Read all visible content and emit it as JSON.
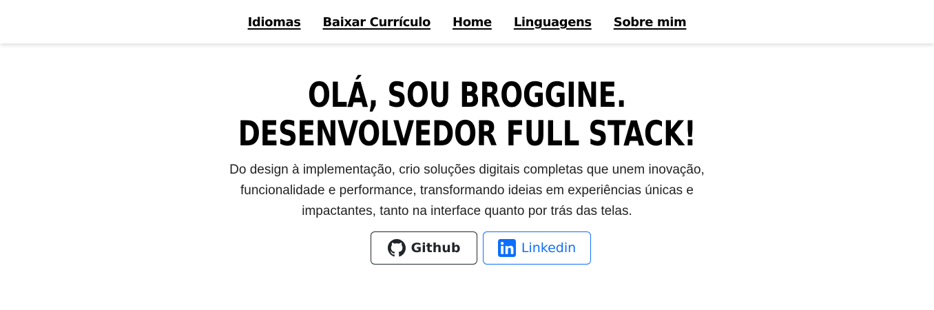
{
  "nav": {
    "items": [
      {
        "label": "Idiomas"
      },
      {
        "label": "Baixar Currículo"
      },
      {
        "label": "Home"
      },
      {
        "label": "Linguagens"
      },
      {
        "label": "Sobre mim"
      }
    ]
  },
  "hero": {
    "title_line1": "Olá, sou Broggine.",
    "title_line2": "Desenvolvedor Full Stack!",
    "description": "Do design à implementação, crio soluções digitais completas que unem inovação, funcionalidade e performance, transformando ideias em experiências únicas e impactantes, tanto na interface quanto por trás das telas."
  },
  "buttons": {
    "github": {
      "label": "Github",
      "icon": "github-icon",
      "color": "#212529"
    },
    "linkedin": {
      "label": "Linkedin",
      "icon": "linkedin-icon",
      "color": "#0d6efd"
    }
  }
}
